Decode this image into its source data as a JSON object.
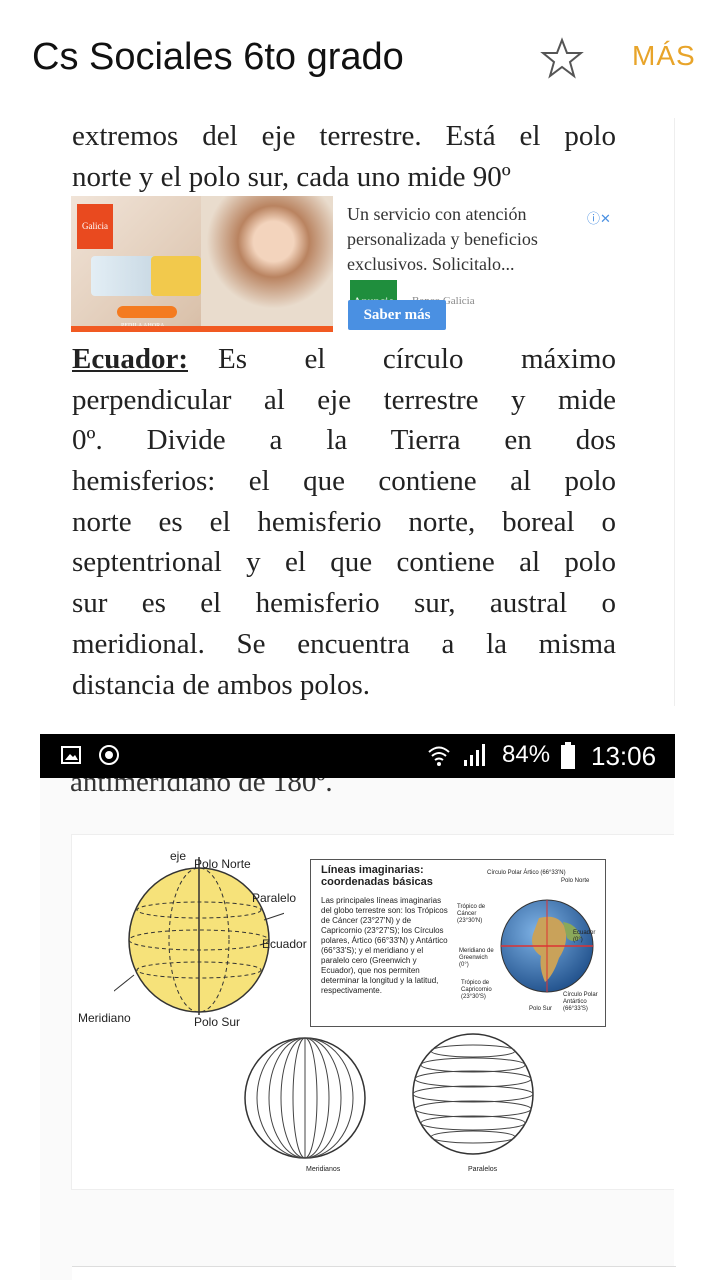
{
  "appbar": {
    "title": "Cs Sociales 6to grado",
    "more_label": "MÁS",
    "star_icon": "star-outline-icon"
  },
  "page1": {
    "lines_top": [
      "extremos del eje terrestre. Está el polo",
      "norte y el polo sur, cada uno mide 90º"
    ],
    "ad": {
      "brand": "Galicia",
      "bonificada": "100% BONIFICADA",
      "pedila": "PEDILA AHORA",
      "text": "Un servicio con atención personalizada y beneficios exclusivos. Solicitalo...",
      "badge": "Anuncio",
      "advertiser": "Banco Galicia",
      "cta": "Saber más"
    },
    "ecuador_term": "Ecuador:",
    "ecuador_line1_rest": "Es el círculo máximo",
    "lines_body": [
      "perpendicular al eje terrestre y mide",
      "0º. Divide a la Tierra en dos",
      "hemisferios: el que contiene al polo",
      "norte es el hemisferio norte, boreal o",
      "septentrional y el que contiene al polo",
      "sur es el hemisferio sur, austral o",
      "meridional. Se encuentra a la misma"
    ],
    "last_line": "distancia de ambos polos."
  },
  "statusbar": {
    "battery": "84%",
    "time": "13:06"
  },
  "page2": {
    "cutoff_text": "antimeridiano de 180º.",
    "figure": {
      "eje": "eje",
      "polo_norte": "Polo Norte",
      "paralelo": "Paralelo",
      "ecuador": "Ecuador",
      "meridiano": "Meridiano",
      "polo_sur": "Polo Sur",
      "box_title": "Líneas imaginarias: coordenadas básicas",
      "box_text": "Las principales líneas imaginarias del globo terrestre son: los Trópicos de Cáncer (23°27'N) y de Capricornio (23°27'S); los Círculos polares, Ártico (66°33'N) y Antártico (66°33'S); y el meridiano y el paralelo cero (Greenwich y Ecuador), que nos permiten determinar la longitud y la latitud, respectivamente.",
      "circulo_polar_artico": "Círculo Polar Ártico (66°33'N)",
      "polo_norte_small": "Polo Norte",
      "tropico_cancer": "Trópico de Cáncer (23°30'N)",
      "ecuador_small": "Ecuador (0°)",
      "meridiano_greenwich": "Meridiano de Greenwich (0°)",
      "tropico_capricornio": "Trópico de Capricornio (23°30'S)",
      "polo_sur_small": "Polo Sur",
      "circulo_polar_antartico": "Círculo Polar Antártico (66°33'S)",
      "meridianos_caption": "Meridianos",
      "paralelos_caption": "Paralelos"
    }
  }
}
